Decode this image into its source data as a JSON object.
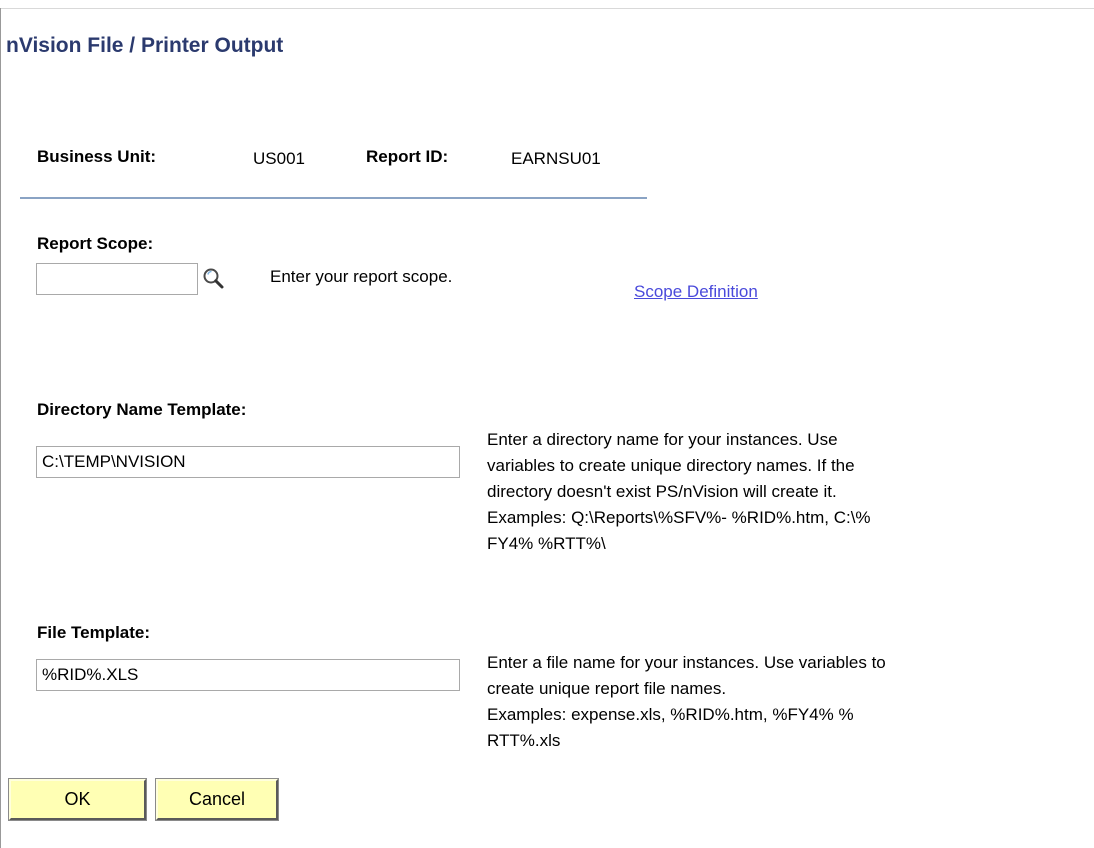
{
  "page": {
    "title": "nVision File / Printer Output"
  },
  "header": {
    "business_unit_label": "Business Unit:",
    "business_unit_value": "US001",
    "report_id_label": "Report ID:",
    "report_id_value": "EARNSU01"
  },
  "report_scope": {
    "label": "Report Scope:",
    "value": "",
    "lookup_icon": "magnifier-icon",
    "hint": "Enter your report scope.",
    "link_text": "Scope Definition"
  },
  "directory_template": {
    "label": "Directory Name Template:",
    "value": "C:\\TEMP\\NVISION",
    "hint_lines": [
      "Enter a directory name for your instances. Use",
      "variables to create unique directory names. If the",
      "directory doesn't exist PS/nVision will create it.",
      "Examples: Q:\\Reports\\%SFV%- %RID%.htm, C:\\%",
      "FY4% %RTT%\\"
    ]
  },
  "file_template": {
    "label": "File Template:",
    "value": "%RID%.XLS",
    "hint_lines": [
      "Enter a file name for your instances. Use variables to",
      "create unique report file names.",
      "Examples: expense.xls, %RID%.htm, %FY4% %",
      "RTT%.xls"
    ]
  },
  "buttons": {
    "ok_label": "OK",
    "cancel_label": "Cancel",
    "color": "#ffffb4"
  },
  "colors": {
    "title": "#2b3a6e",
    "link": "#4a4adb",
    "divider": "#8aa3c4"
  }
}
